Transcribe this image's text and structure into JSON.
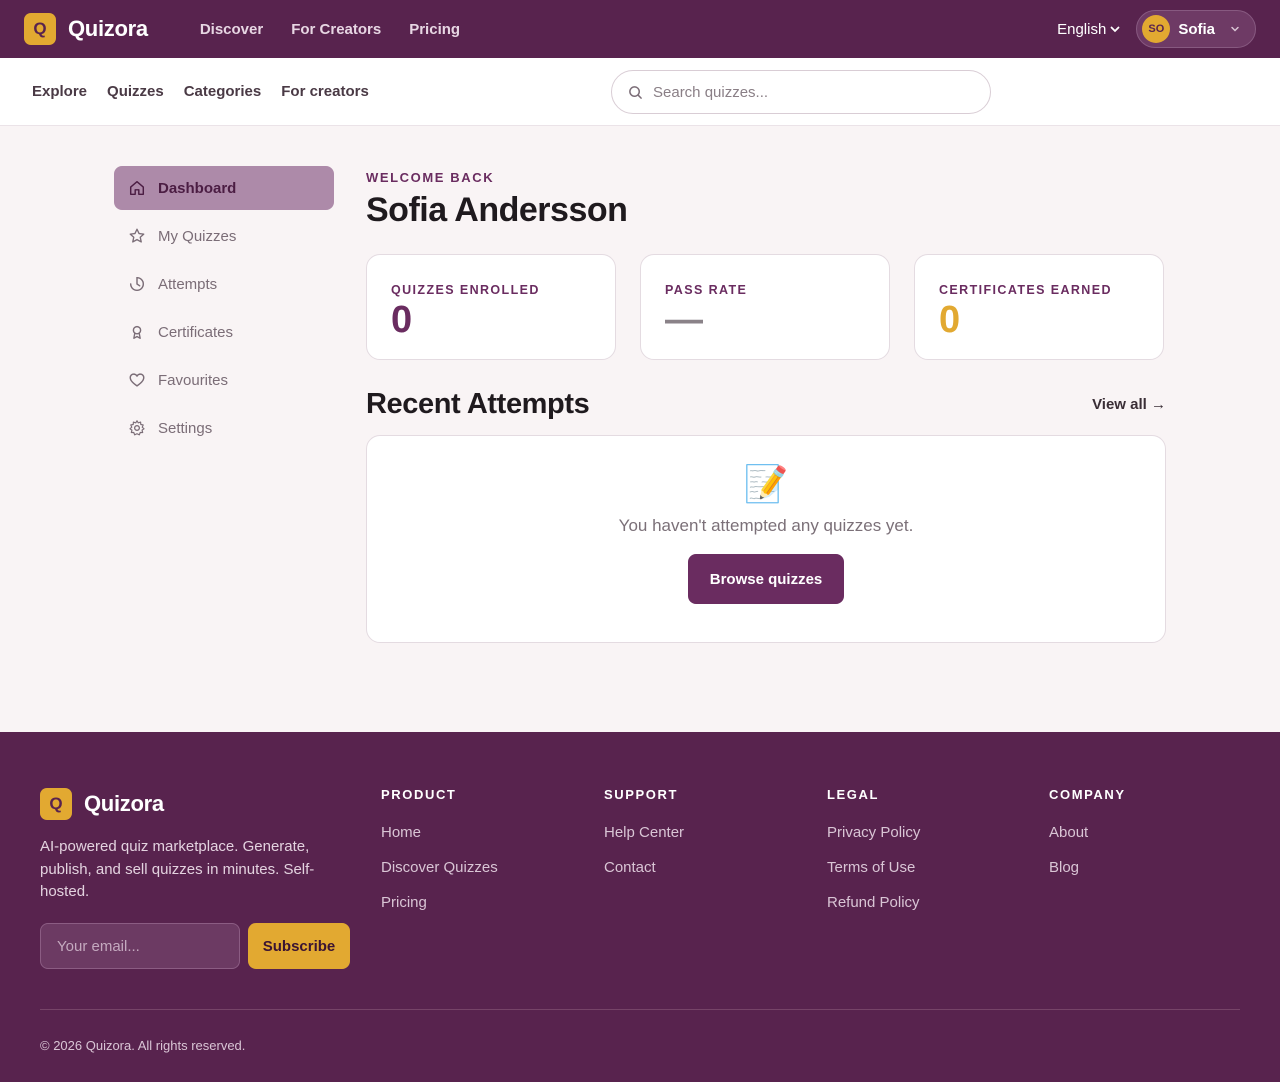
{
  "brand": {
    "name": "Quizora",
    "logo_letter": "Q",
    "accent": "#e2a931",
    "primary": "#58234e"
  },
  "topnav": {
    "items": [
      "Discover",
      "For Creators",
      "Pricing"
    ]
  },
  "header": {
    "language": "English",
    "user_initials": "SO",
    "user_name": "Sofia"
  },
  "subnav": {
    "items": [
      "Explore",
      "Quizzes",
      "Categories",
      "For creators"
    ]
  },
  "search": {
    "placeholder": "Search quizzes..."
  },
  "sidebar": {
    "items": [
      {
        "label": "Dashboard",
        "icon": "home-icon",
        "active": true
      },
      {
        "label": "My Quizzes",
        "icon": "star-icon"
      },
      {
        "label": "Attempts",
        "icon": "clock-icon"
      },
      {
        "label": "Certificates",
        "icon": "award-icon"
      },
      {
        "label": "Favourites",
        "icon": "heart-icon"
      },
      {
        "label": "Settings",
        "icon": "gear-icon"
      }
    ]
  },
  "dashboard": {
    "eyebrow": "WELCOME BACK",
    "name": "Sofia Andersson",
    "stats": [
      {
        "label": "QUIZZES ENROLLED",
        "value": "0"
      },
      {
        "label": "PASS RATE",
        "value": "—"
      },
      {
        "label": "CERTIFICATES EARNED",
        "value": "0"
      }
    ],
    "recent_title": "Recent Attempts",
    "view_all": "View all →",
    "empty_icon": "📝",
    "empty_text": "You haven't attempted any quizzes yet.",
    "browse_label": "Browse quizzes"
  },
  "footer": {
    "brand": "Quizora",
    "description": "AI-powered quiz marketplace. Generate, publish, and sell quizzes in minutes. Self-hosted.",
    "email_placeholder": "Your email...",
    "subscribe_label": "Subscribe",
    "columns": [
      {
        "title": "PRODUCT",
        "links": [
          "Home",
          "Discover Quizzes",
          "Pricing"
        ]
      },
      {
        "title": "SUPPORT",
        "links": [
          "Help Center",
          "Contact"
        ]
      },
      {
        "title": "LEGAL",
        "links": [
          "Privacy Policy",
          "Terms of Use",
          "Refund Policy"
        ]
      },
      {
        "title": "COMPANY",
        "links": [
          "About",
          "Blog"
        ]
      }
    ],
    "copyright": "© 2026 Quizora. All rights reserved."
  }
}
